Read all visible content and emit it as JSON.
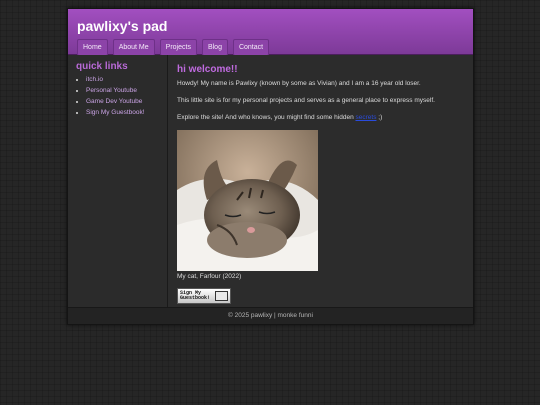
{
  "header": {
    "title": "pawlixy's pad"
  },
  "nav": [
    {
      "label": "Home"
    },
    {
      "label": "About Me"
    },
    {
      "label": "Projects"
    },
    {
      "label": "Blog"
    },
    {
      "label": "Contact"
    }
  ],
  "sidebar": {
    "heading": "quick links",
    "links": [
      "itch.io",
      "Personal Youtube",
      "Game Dev Youtube",
      "Sign My Guestbook!"
    ]
  },
  "main": {
    "heading": "hi welcome!!",
    "intro": "Howdy! My name is Pawlixy (known by some as Vivian) and I am a 16 year old loser.",
    "purpose": "This little site is for my personal projects and serves as a general place to express myself.",
    "explore_before": "Explore the site! And who knows, you might find some hidden ",
    "explore_link": "secrets",
    "explore_after": " ;)",
    "photo_caption": "My cat, Farfour (2022)",
    "guestbook_button_text": "Sign My Guestbook!"
  },
  "footer": {
    "text": "© 2025 pawlixy | monke funni"
  },
  "colors": {
    "accent": "#a24fc0",
    "heading": "#c06be0",
    "background": "#262626"
  }
}
